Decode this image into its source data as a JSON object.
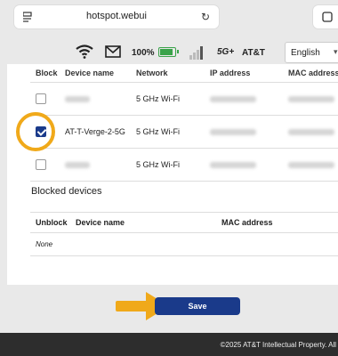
{
  "browser": {
    "url": "hotspot.webui"
  },
  "status": {
    "battery_pct": "100%",
    "battery_level": 1.0,
    "network": "5G+",
    "carrier": "AT&T",
    "language": "English"
  },
  "devices_table": {
    "headers": [
      "Block",
      "Device name",
      "Network",
      "IP address",
      "MAC address"
    ],
    "rows": [
      {
        "blocked": false,
        "name": "",
        "network": "5 GHz Wi-Fi"
      },
      {
        "blocked": true,
        "name": "AT-T-Verge-2-5G",
        "network": "5 GHz Wi-Fi"
      },
      {
        "blocked": false,
        "name": "",
        "network": "5 GHz Wi-Fi"
      }
    ]
  },
  "blocked_section": {
    "title": "Blocked devices",
    "headers": [
      "Unblock",
      "Device name",
      "MAC address"
    ],
    "empty_text": "None"
  },
  "actions": {
    "save_label": "Save"
  },
  "footer": {
    "copyright": "©2025 AT&T Intellectual Property. All"
  },
  "colors": {
    "primary": "#1a3a8a",
    "highlight": "#f0a91a",
    "battery": "#3aa34a"
  }
}
